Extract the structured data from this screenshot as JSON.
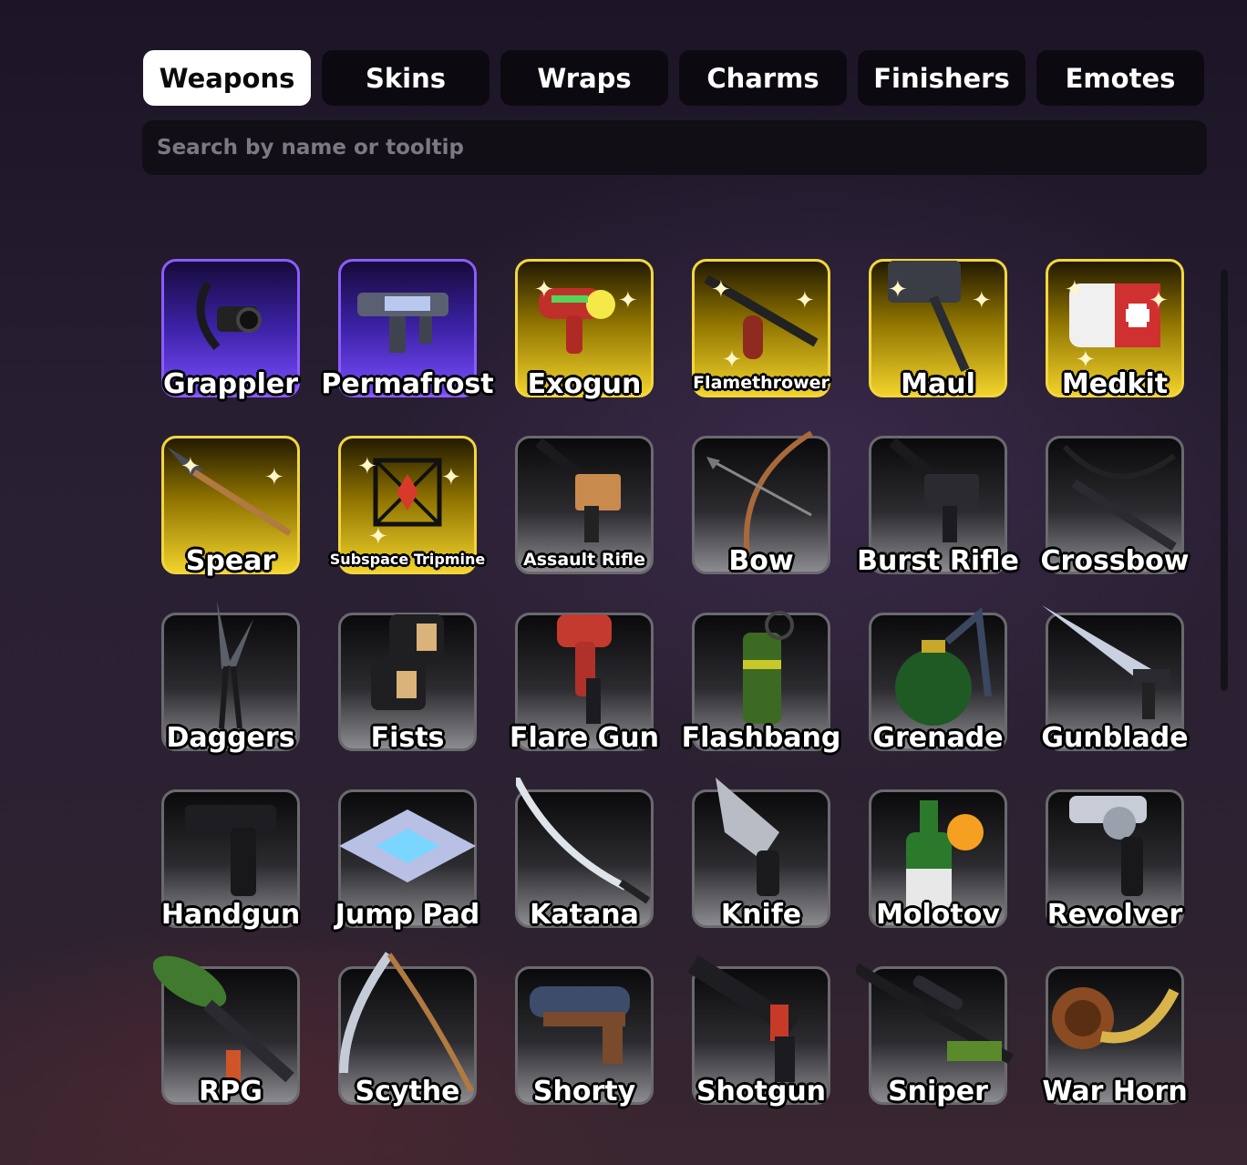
{
  "tabs": [
    {
      "label": "Weapons",
      "active": true
    },
    {
      "label": "Skins",
      "active": false
    },
    {
      "label": "Wraps",
      "active": false
    },
    {
      "label": "Charms",
      "active": false
    },
    {
      "label": "Finishers",
      "active": false
    },
    {
      "label": "Emotes",
      "active": false
    }
  ],
  "search": {
    "placeholder": "Search by name or tooltip",
    "value": ""
  },
  "items": [
    {
      "name": "Grappler",
      "rarity": "purple",
      "icon": "grapple-icon"
    },
    {
      "name": "Permafrost",
      "rarity": "purple",
      "icon": "ice-gun-icon"
    },
    {
      "name": "Exogun",
      "rarity": "gold",
      "icon": "ray-gun-icon"
    },
    {
      "name": "Flamethrower",
      "rarity": "gold",
      "icon": "flamethrower-icon"
    },
    {
      "name": "Maul",
      "rarity": "gold",
      "icon": "hammer-icon"
    },
    {
      "name": "Medkit",
      "rarity": "gold",
      "icon": "medkit-icon"
    },
    {
      "name": "Spear",
      "rarity": "gold",
      "icon": "spear-icon"
    },
    {
      "name": "Subspace Tripmine",
      "rarity": "gold",
      "icon": "tripmine-icon"
    },
    {
      "name": "Assault Rifle",
      "rarity": "common",
      "icon": "assault-rifle-icon"
    },
    {
      "name": "Bow",
      "rarity": "common",
      "icon": "bow-icon"
    },
    {
      "name": "Burst Rifle",
      "rarity": "common",
      "icon": "burst-rifle-icon"
    },
    {
      "name": "Crossbow",
      "rarity": "common",
      "icon": "crossbow-icon"
    },
    {
      "name": "Daggers",
      "rarity": "common",
      "icon": "daggers-icon"
    },
    {
      "name": "Fists",
      "rarity": "common",
      "icon": "fists-icon"
    },
    {
      "name": "Flare Gun",
      "rarity": "common",
      "icon": "flare-gun-icon"
    },
    {
      "name": "Flashbang",
      "rarity": "common",
      "icon": "flashbang-icon"
    },
    {
      "name": "Grenade",
      "rarity": "common",
      "icon": "grenade-icon"
    },
    {
      "name": "Gunblade",
      "rarity": "common",
      "icon": "gunblade-icon"
    },
    {
      "name": "Handgun",
      "rarity": "common",
      "icon": "handgun-icon"
    },
    {
      "name": "Jump Pad",
      "rarity": "common",
      "icon": "jump-pad-icon"
    },
    {
      "name": "Katana",
      "rarity": "common",
      "icon": "katana-icon"
    },
    {
      "name": "Knife",
      "rarity": "common",
      "icon": "knife-icon"
    },
    {
      "name": "Molotov",
      "rarity": "common",
      "icon": "molotov-icon"
    },
    {
      "name": "Revolver",
      "rarity": "common",
      "icon": "revolver-icon"
    },
    {
      "name": "RPG",
      "rarity": "common",
      "icon": "rpg-icon"
    },
    {
      "name": "Scythe",
      "rarity": "common",
      "icon": "scythe-icon"
    },
    {
      "name": "Shorty",
      "rarity": "common",
      "icon": "shorty-icon"
    },
    {
      "name": "Shotgun",
      "rarity": "common",
      "icon": "shotgun-icon"
    },
    {
      "name": "Sniper",
      "rarity": "common",
      "icon": "sniper-icon"
    },
    {
      "name": "War Horn",
      "rarity": "common",
      "icon": "war-horn-icon"
    }
  ],
  "colors": {
    "gold_border": "#f3d63e",
    "purple_border": "#8c5cff",
    "common_border": "#6a6a6e",
    "active_tab": "#ffffff",
    "inactive_tab": "#0c0a10"
  }
}
